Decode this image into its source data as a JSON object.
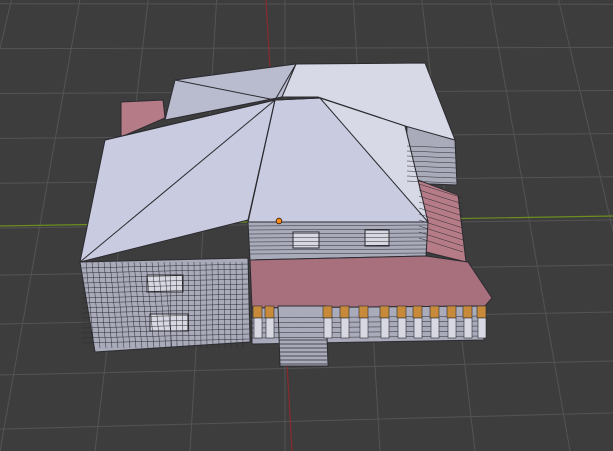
{
  "viewport": {
    "mode": "Edit Mode",
    "background_color": "#3d3d3d",
    "grid_color": "#545454",
    "axis_x_color": "#6c8f1f",
    "axis_y_color": "#8a2a2f"
  },
  "model": {
    "roof_color": "#c9cbe0",
    "roof_light_color": "#d8d9e6",
    "roof_shadow_color": "#b9bbcf",
    "wall_color": "#a9abbb",
    "edge_color": "#2b2b30",
    "selected_face_color": "#b57b86",
    "porch_floor_color": "#a8707c",
    "pillar_color": "#d7d8e2",
    "pillar_cap_color": "#c78a3a",
    "origin_color": "#ff8c1a"
  }
}
